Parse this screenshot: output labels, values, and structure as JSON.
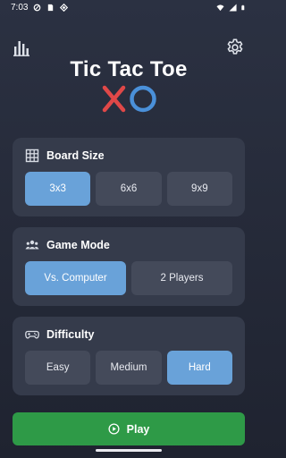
{
  "status_bar": {
    "time": "7:03"
  },
  "header": {
    "title": "Tic Tac Toe"
  },
  "board_size": {
    "title": "Board Size",
    "options": [
      "3x3",
      "6x6",
      "9x9"
    ],
    "selected": "3x3"
  },
  "game_mode": {
    "title": "Game Mode",
    "options": [
      "Vs. Computer",
      "2 Players"
    ],
    "selected": "Vs. Computer"
  },
  "difficulty": {
    "title": "Difficulty",
    "options": [
      "Easy",
      "Medium",
      "Hard"
    ],
    "selected": "Hard"
  },
  "play_button": {
    "label": "Play"
  },
  "colors": {
    "background": "#262b3a",
    "card": "#353b4b",
    "option": "#444a5a",
    "selected": "#69a2d9",
    "play": "#2e9a47",
    "logo_x": "#e04848",
    "logo_o": "#4a90d9"
  },
  "icons": [
    "stats-icon",
    "settings-icon",
    "grid-icon",
    "group-icon",
    "game-icon",
    "play-circle-icon"
  ]
}
